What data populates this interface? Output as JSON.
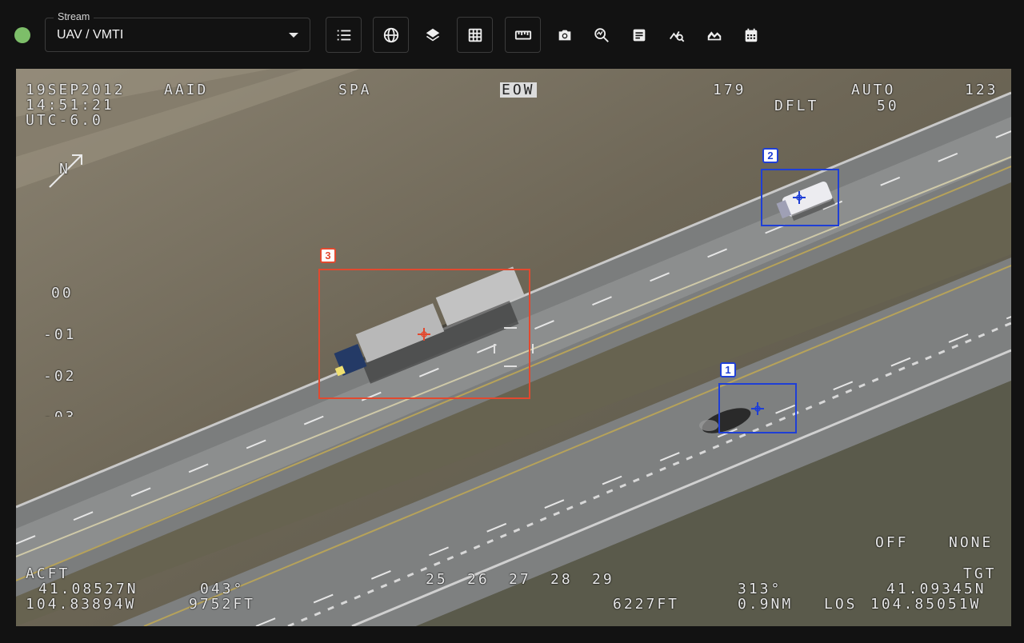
{
  "stream": {
    "legend": "Stream",
    "value": "UAV / VMTI"
  },
  "toolbar": {
    "buttons": [
      "list-icon",
      "globe-icon",
      "layers-icon",
      "grid-icon",
      "ruler-icon"
    ],
    "icons": [
      "camera-icon",
      "zoom-analytics-icon",
      "notes-icon",
      "search-chart-icon",
      "area-chart-icon",
      "calendar-icon"
    ]
  },
  "osd": {
    "date": "19SEP2012",
    "sensor": "AAID",
    "time": "14:51:21",
    "tz": "UTC-6.0",
    "spa": "SPA",
    "eow": "EOW",
    "num179": "179",
    "auto": "AUTO",
    "num123": "123",
    "dflt": "DFLT",
    "num50": "50",
    "north": "N",
    "elev": [
      "00",
      "-01",
      "-02",
      "-03"
    ],
    "off": "OFF",
    "none": "NONE",
    "acft": "ACFT",
    "acft_lat": "41.08527N",
    "acft_lon": "104.83894W",
    "heading": "043°",
    "alt": "9752FT",
    "scale": [
      "25",
      "26",
      "27",
      "28",
      "29"
    ],
    "slant": "6227FT",
    "bearing": "313°",
    "range": "0.9NM",
    "los": "LOS",
    "tgt": "TGT",
    "tgt_lat": "41.09345N",
    "tgt_lon": "104.85051W"
  },
  "tracks": [
    {
      "id": "1",
      "color": "#1f3fd6"
    },
    {
      "id": "2",
      "color": "#1f3fd6"
    },
    {
      "id": "3",
      "color": "#e2492f"
    }
  ]
}
